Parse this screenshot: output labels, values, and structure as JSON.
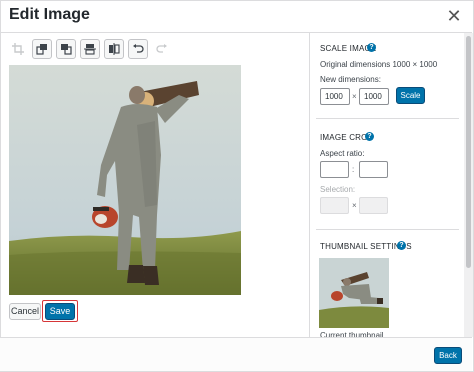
{
  "dialog": {
    "title": "Edit Image",
    "close_glyph": "✕"
  },
  "toolbar": {
    "tools": [
      {
        "name": "crop",
        "icon": "crop-icon"
      },
      {
        "name": "rotate-left",
        "icon": "rotate-left-icon"
      },
      {
        "name": "rotate-right",
        "icon": "rotate-right-icon"
      },
      {
        "name": "flip-vertical",
        "icon": "flip-vertical-icon"
      },
      {
        "name": "flip-horizontal",
        "icon": "flip-horizontal-icon"
      },
      {
        "name": "undo",
        "icon": "undo-icon"
      },
      {
        "name": "redo",
        "icon": "redo-icon"
      }
    ]
  },
  "actions": {
    "cancel_label": "Cancel",
    "save_label": "Save"
  },
  "scale": {
    "title": "SCALE IMAGE",
    "help_glyph": "?",
    "original_label": "Original dimensions 1000 × 1000",
    "new_label": "New dimensions:",
    "width_value": "1000",
    "height_value": "1000",
    "times_glyph": "×",
    "button_label": "Scale"
  },
  "crop": {
    "title": "IMAGE CROP",
    "help_glyph": "?",
    "aspect_label": "Aspect ratio:",
    "aspect_sep": ":",
    "selection_label": "Selection:",
    "selection_sep": "×"
  },
  "thumbnail": {
    "title": "THUMBNAIL SETTINGS",
    "help_glyph": "?",
    "caption": "Current thumbnail"
  },
  "footer": {
    "back_label": "Back"
  },
  "colors": {
    "primary": "#0073aa",
    "highlight_border": "#d63638"
  }
}
